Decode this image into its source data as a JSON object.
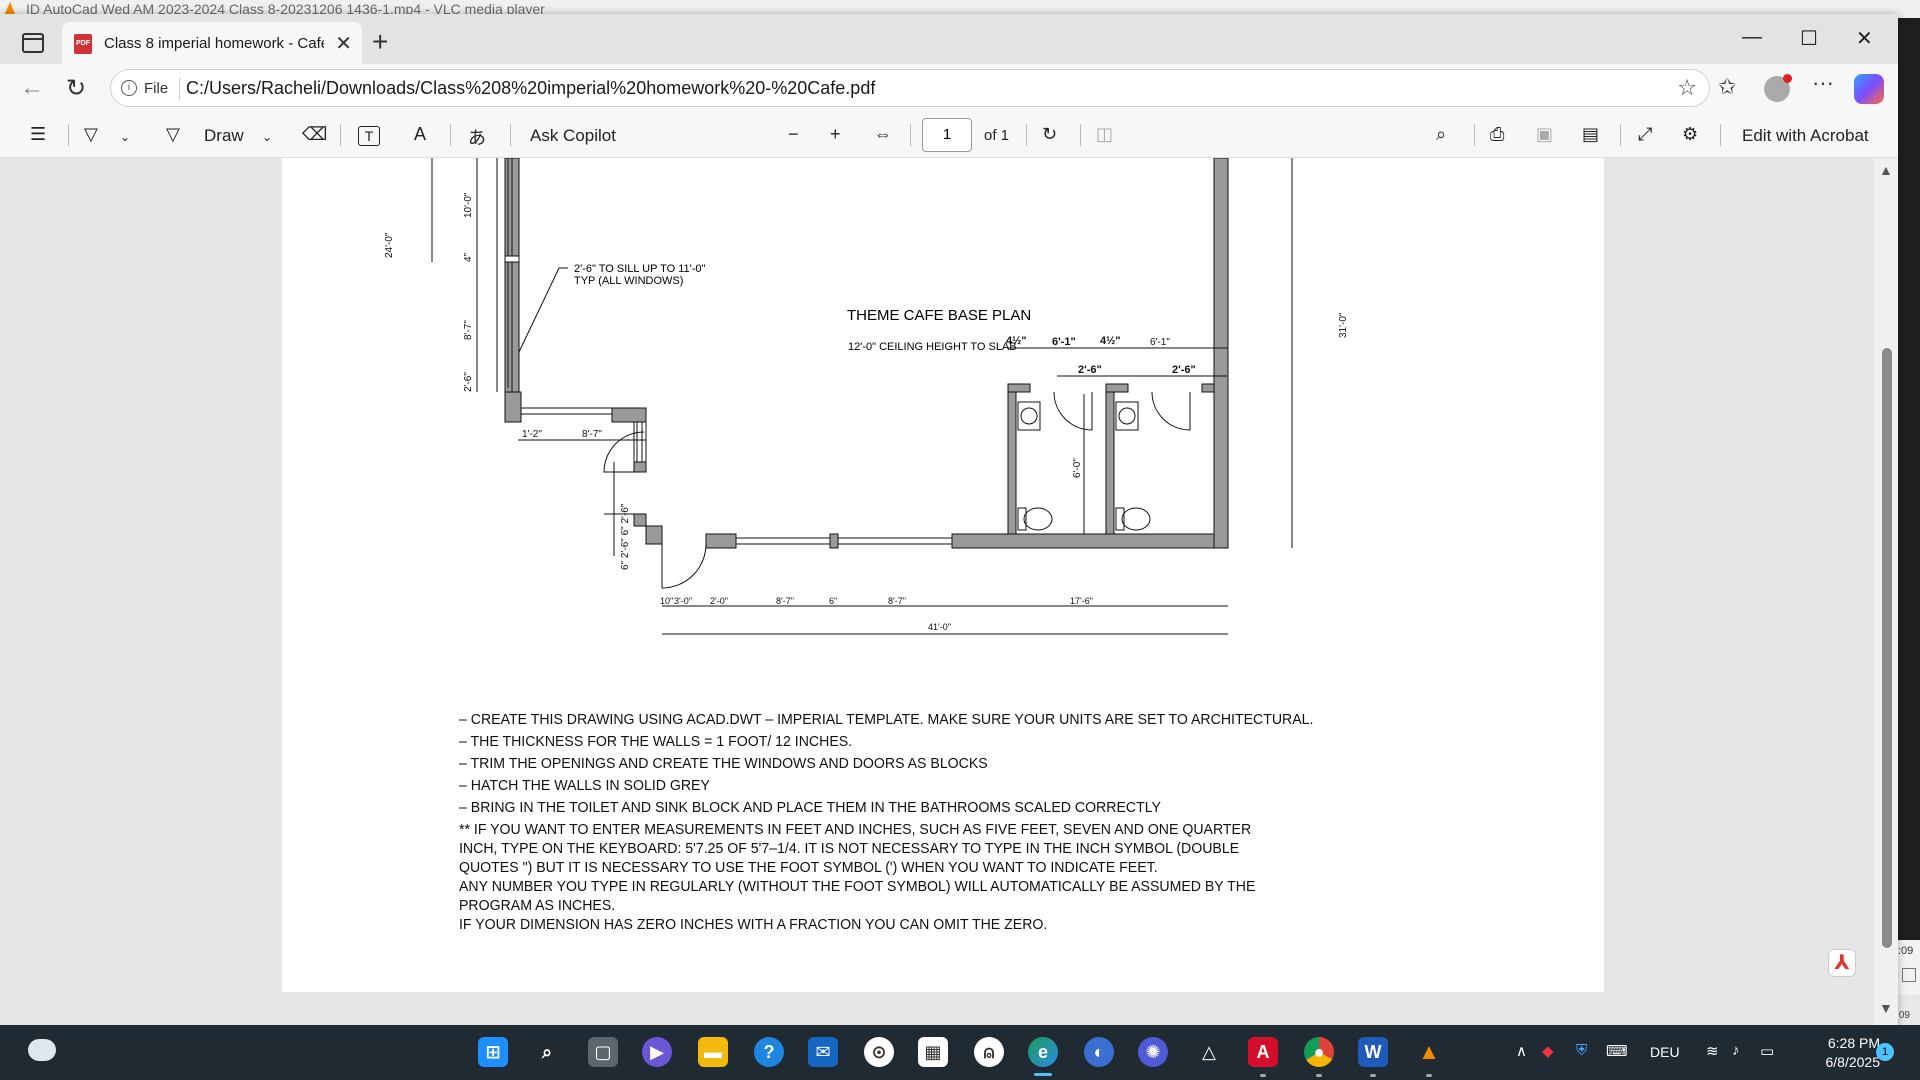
{
  "vlc": {
    "title": "ID AutoCad Wed AM 2023-2024 Class 8-20231206 1436-1.mp4 - VLC media player",
    "time_top": ":09",
    "time_bottom": ":09"
  },
  "browser": {
    "tab_title": "Class 8 imperial homework - Cafe",
    "address_label": "File",
    "url": "C:/Users/Racheli/Downloads/Class%208%20imperial%20homework%20-%20Cafe.pdf"
  },
  "toolbar": {
    "draw_label": "Draw",
    "ask_copilot": "Ask Copilot",
    "page_number": "1",
    "page_of": "of 1",
    "edit_acrobat": "Edit with Acrobat"
  },
  "drawing": {
    "title": "THEME CAFE BASE PLAN",
    "subtitle": "12'-0\" CEILING HEIGHT TO SLAB",
    "callout_line1": "2'-6\" TO SILL UP TO 11'-0\"",
    "callout_line2": "TYP (ALL WINDOWS)",
    "dims": {
      "left_10": "10'-0\"",
      "left_24": "24'-0\"",
      "left_4": "4\"",
      "left_87": "8'-7\"",
      "left_26": "2'-6\"",
      "bump_12": "1'-2\"",
      "bump_87": "8'-7\"",
      "door_v": "6\" 2'-6\" 6\" 2'-6\"",
      "right_31": "31'-0\"",
      "wc_a": "4½\"",
      "wc_b": "6'-1\"",
      "wc_c": "4½\"",
      "wc_d": "6'-1\"",
      "wc_door1": "2'-6\"",
      "wc_door2": "2'-6\"",
      "wc_v": "6'-0\"",
      "bot_10": "10\"",
      "bot_30": "3'-0\"",
      "bot_20": "2'-0\"",
      "bot_87a": "8'-7\"",
      "bot_6": "6\"",
      "bot_87b": "8'-7\"",
      "bot_176": "17'-6\"",
      "bot_41": "41'-0\""
    }
  },
  "notes": [
    "–  CREATE THIS DRAWING USING ACAD.DWT – IMPERIAL TEMPLATE. MAKE SURE YOUR UNITS ARE SET TO ARCHITECTURAL.",
    "–  THE THICKNESS FOR THE WALLS = 1 FOOT/ 12 INCHES.",
    "–  TRIM THE OPENINGS AND CREATE THE WINDOWS AND DOORS AS BLOCKS",
    "–  HATCH THE WALLS IN SOLID GREY",
    "–  BRING IN THE TOILET AND SINK BLOCK AND PLACE THEM IN THE BATHROOMS SCALED CORRECTLY",
    "** IF YOU WANT TO ENTER MEASUREMENTS IN FEET AND INCHES, SUCH AS FIVE FEET, SEVEN AND ONE QUARTER",
    "INCH, TYPE ON THE KEYBOARD: 5'7.25 OF 5'7–1/4. IT IS NOT NECESSARY TO TYPE IN THE INCH SYMBOL (DOUBLE",
    "QUOTES \") BUT IT IS NECESSARY TO USE THE FOOT SYMBOL (') WHEN YOU WANT TO INDICATE FEET.",
    "ANY NUMBER YOU TYPE IN REGULARLY (WITHOUT THE FOOT SYMBOL) WILL AUTOMATICALLY BE ASSUMED BY THE",
    "PROGRAM AS INCHES.",
    "IF YOUR DIMENSION HAS ZERO INCHES WITH A FRACTION YOU CAN OMIT THE ZERO."
  ],
  "taskbar": {
    "language": "DEU",
    "time": "6:28 PM",
    "date": "6/8/2025",
    "notifications": "1"
  }
}
